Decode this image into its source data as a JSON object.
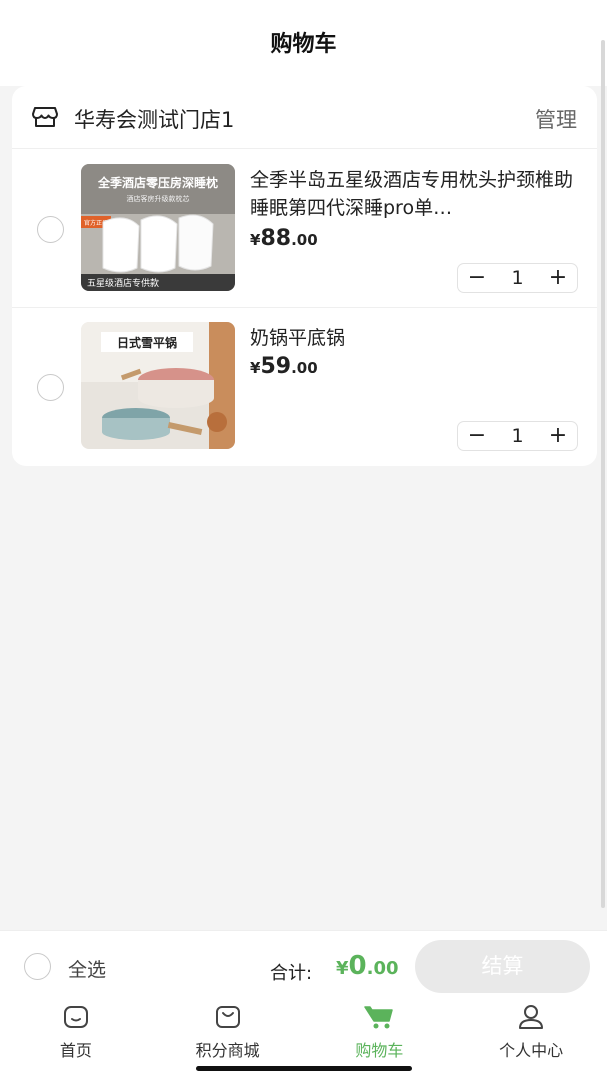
{
  "header": {
    "title": "购物车"
  },
  "store": {
    "name": "华寿会测试门店1",
    "manage_label": "管理"
  },
  "items": [
    {
      "title": "全季半岛五星级酒店专用枕头护颈椎助睡眠第四代深睡pro单…",
      "price_currency": "¥",
      "price_int": "88",
      "price_dec": ".00",
      "quantity": "1",
      "thumb_caption_top": "全季酒店零压房深睡枕",
      "thumb_caption_sub": "酒店客房升级款枕芯",
      "thumb_badge": "官方正品",
      "thumb_caption_bottom": "五星级酒店专供款"
    },
    {
      "title": "奶锅平底锅",
      "price_currency": "¥",
      "price_int": "59",
      "price_dec": ".00",
      "quantity": "1",
      "thumb_caption_top": "日式雪平锅"
    }
  ],
  "stepper": {
    "minus": "−",
    "plus": "+"
  },
  "bottom_bar": {
    "select_all_label": "全选",
    "total_label": "合计:",
    "total_currency": "¥",
    "total_int": "0",
    "total_dec": ".00",
    "checkout_label": "结算"
  },
  "tabbar": [
    {
      "label": "首页",
      "icon": "home-icon"
    },
    {
      "label": "积分商城",
      "icon": "shopping-bag-icon"
    },
    {
      "label": "购物车",
      "icon": "cart-icon",
      "active": true
    },
    {
      "label": "个人中心",
      "icon": "user-icon"
    }
  ],
  "colors": {
    "accent": "#5bb35b",
    "checkout_disabled": "#e9e9e9",
    "background": "#f4f4f4"
  }
}
